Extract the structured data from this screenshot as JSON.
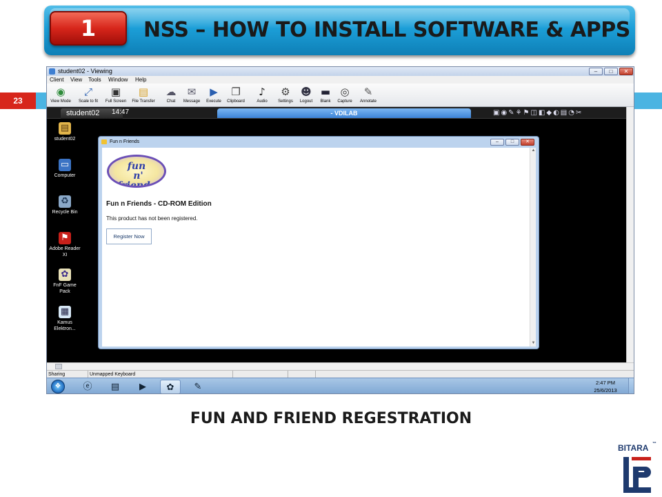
{
  "slide": {
    "number_badge": "1",
    "title": "NSS – HOW TO INSTALL SOFTWARE & APPS",
    "page_number": "23",
    "caption": "FUN AND FRIEND REGESTRATION",
    "brand": "BITARA",
    "brand_tm": "™"
  },
  "viewer": {
    "title": "student02 - Viewing",
    "window_buttons": [
      "–",
      "□",
      "✕"
    ],
    "menu": [
      "Client",
      "View",
      "Tools",
      "Window",
      "Help"
    ],
    "toolbar": [
      {
        "label": "View Mode",
        "icon": "eye-icon"
      },
      {
        "label": "Scale to fit",
        "icon": "scale-icon"
      },
      {
        "label": "Full Screen",
        "icon": "fullscreen-icon"
      },
      {
        "label": "File Transfer",
        "icon": "folder-icon"
      },
      {
        "label": "Chat",
        "icon": "chat-icon"
      },
      {
        "label": "Message",
        "icon": "message-icon"
      },
      {
        "label": "Execute",
        "icon": "execute-icon"
      },
      {
        "label": "Clipboard",
        "icon": "clipboard-icon"
      },
      {
        "label": "Audio",
        "icon": "microphone-icon"
      },
      {
        "label": "Settings",
        "icon": "settings-icon"
      },
      {
        "label": "Logout",
        "icon": "logout-icon"
      },
      {
        "label": "Blank",
        "icon": "monitor-icon"
      },
      {
        "label": "Capture",
        "icon": "camera-icon"
      },
      {
        "label": "Annotate",
        "icon": "annotate-icon"
      }
    ],
    "remote": {
      "tab_label": "student02",
      "time": "14:47",
      "session_label": "- VDILAB",
      "desktop_icons": [
        {
          "label": "student02",
          "icon": "user-folder-icon"
        },
        {
          "label": "Computer",
          "icon": "computer-icon"
        },
        {
          "label": "Recycle Bin",
          "icon": "recycle-bin-icon"
        },
        {
          "label": "Adobe Reader XI",
          "icon": "adobe-reader-icon"
        },
        {
          "label": "FnF Game Pack",
          "icon": "game-pack-icon"
        },
        {
          "label": "Kamus Elektron...",
          "icon": "kamus-icon"
        }
      ],
      "app_window": {
        "title": "Fun n Friends",
        "logo_text": "fun\n n'\nfriends",
        "heading": "Fun n Friends - CD-ROM Edition",
        "message": "This product has not been registered.",
        "register_button": "Register Now"
      }
    },
    "status": {
      "left": "Sharing",
      "keyboard": "Unmapped Keyboard"
    },
    "taskbar": {
      "clock_time": "2:47 PM",
      "clock_date": "25/6/2013"
    }
  }
}
